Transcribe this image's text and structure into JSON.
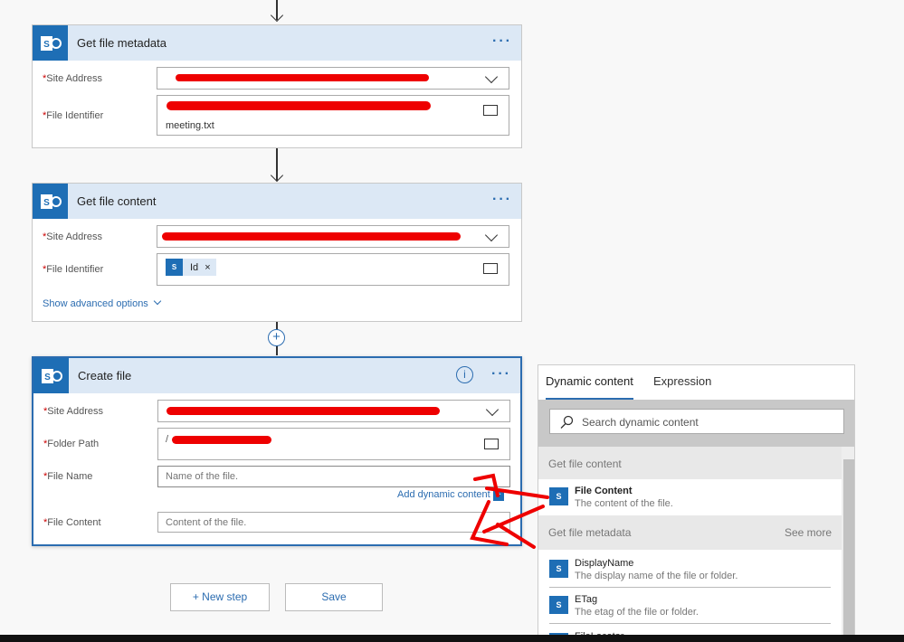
{
  "cards": [
    {
      "title": "Get file metadata",
      "fields": [
        {
          "label": "Site Address"
        },
        {
          "label": "File Identifier",
          "value": "meeting.txt"
        }
      ]
    },
    {
      "title": "Get file content",
      "fields": [
        {
          "label": "Site Address"
        },
        {
          "label": "File Identifier",
          "token": "Id"
        }
      ],
      "advanced": "Show advanced options"
    },
    {
      "title": "Create file",
      "fields": [
        {
          "label": "Site Address"
        },
        {
          "label": "Folder Path",
          "value": "/"
        },
        {
          "label": "File Name",
          "placeholder": "Name of the file."
        },
        {
          "label": "File Content",
          "placeholder": "Content of the file."
        }
      ],
      "add_dynamic": "Add dynamic content"
    }
  ],
  "required_mark": "*",
  "more_glyph": "···",
  "info_glyph": "i",
  "token_close": "×",
  "buttons": {
    "new_step": "+ New step",
    "save": "Save"
  },
  "panel": {
    "tabs": [
      "Dynamic content",
      "Expression"
    ],
    "search_placeholder": "Search dynamic content",
    "sections": [
      {
        "title": "Get file content",
        "items": [
          {
            "name": "File Content",
            "desc": "The content of the file."
          }
        ]
      },
      {
        "title": "Get file metadata",
        "see_more": "See more",
        "items": [
          {
            "name": "DisplayName",
            "desc": "The display name of the file or folder."
          },
          {
            "name": "ETag",
            "desc": "The etag of the file or folder."
          },
          {
            "name": "FileLocator",
            "desc": ""
          }
        ]
      }
    ]
  },
  "colors": {
    "accent": "#2b6cb0",
    "sharepoint": "#1e6eb5",
    "header_bg": "#dce8f5",
    "annotation": "#e00000"
  }
}
